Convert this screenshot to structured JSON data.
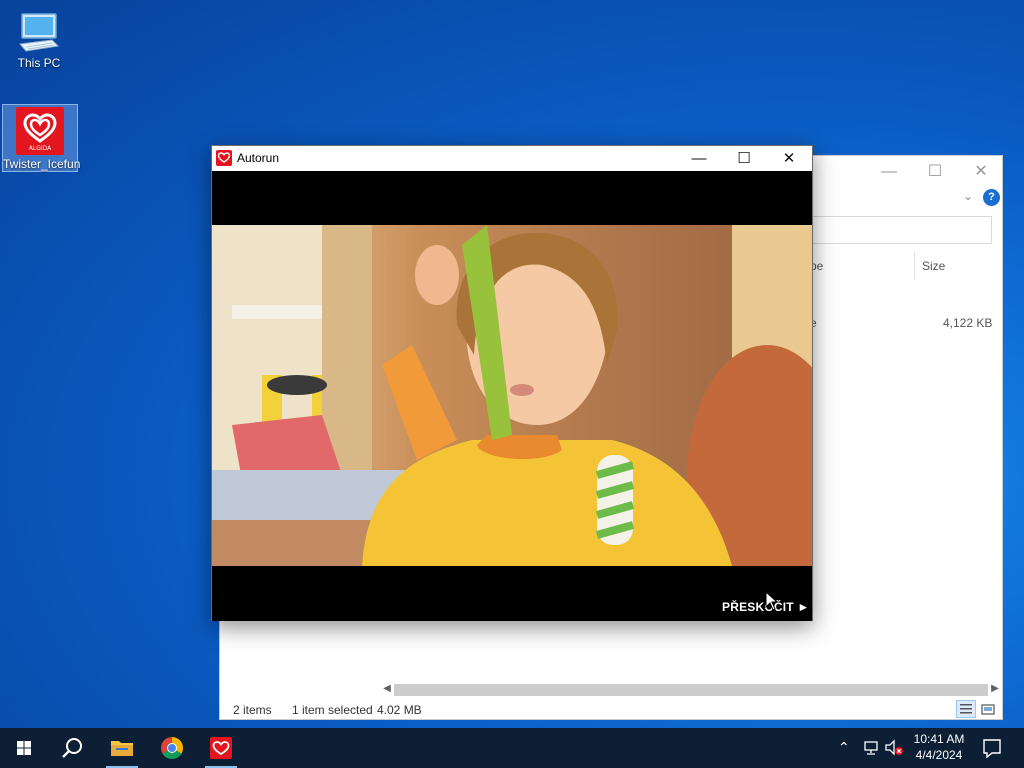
{
  "desktop": {
    "icons": [
      {
        "label": "This PC",
        "icon": "computer-icon"
      },
      {
        "label": "Twister_Icefun",
        "icon": "algida-heart-icon"
      }
    ],
    "logo_text": "ALGIDA"
  },
  "explorer": {
    "columns": {
      "type": "pe",
      "size": "Size"
    },
    "row": {
      "type": "e",
      "size": "4,122 KB"
    },
    "status": {
      "items": "2 items",
      "selected": "1 item selected",
      "size": "4.02 MB"
    },
    "help_icon": "?"
  },
  "autorun": {
    "title": "Autorun",
    "skip_label": "PŘESKOČIT ►",
    "buttons": {
      "minimize": "—",
      "maximize": "☐",
      "close": "✕"
    }
  },
  "taskbar": {
    "time": "10:41 AM",
    "date": "4/4/2024",
    "items": [
      "start-icon",
      "search-icon",
      "file-explorer-icon",
      "chrome-icon",
      "autorun-icon"
    ]
  },
  "colors": {
    "accent": "#0a5bc2",
    "brand_red": "#e3151f",
    "taskbar": "#0d1f34"
  }
}
